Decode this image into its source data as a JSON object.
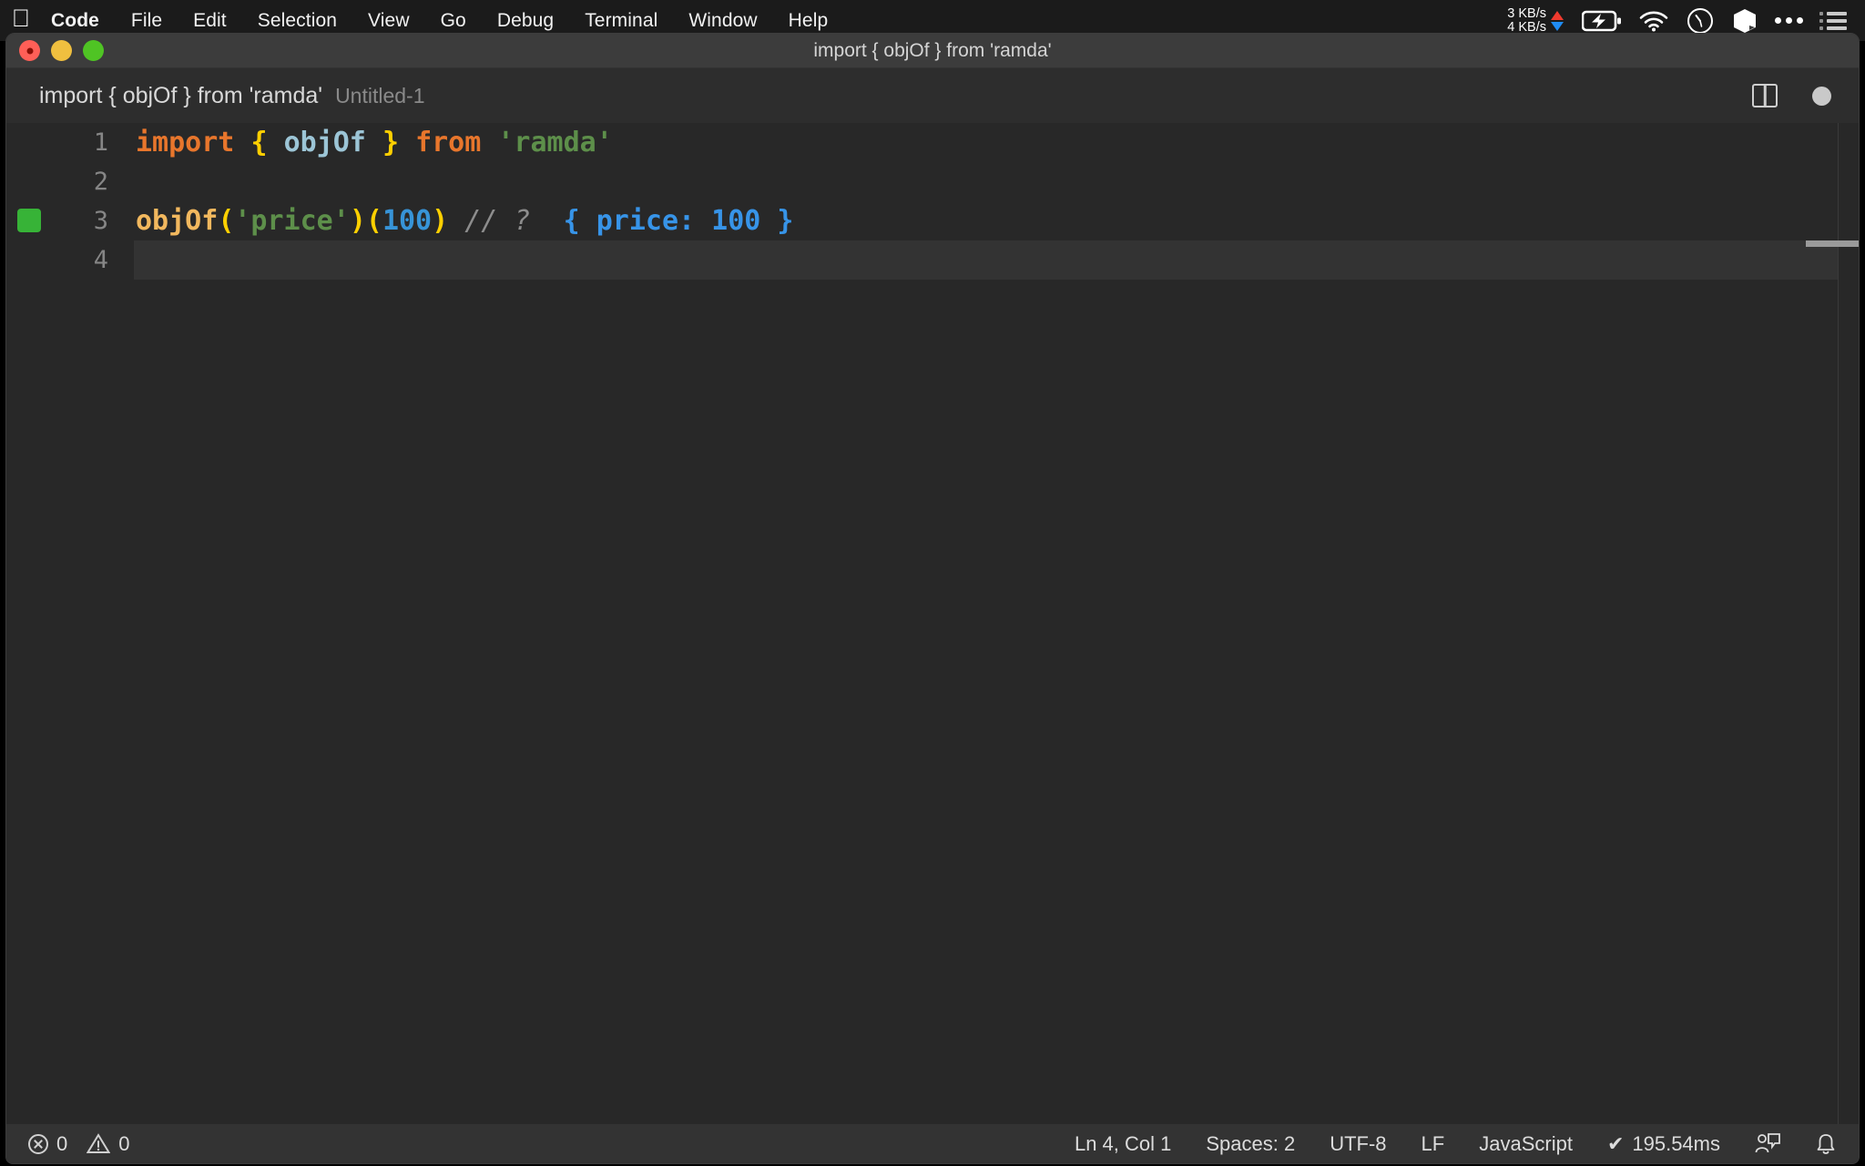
{
  "menubar": {
    "apple_icon": "apple-logo-icon",
    "items": [
      {
        "label": "Code",
        "bold": true
      },
      {
        "label": "File",
        "bold": false
      },
      {
        "label": "Edit",
        "bold": false
      },
      {
        "label": "Selection",
        "bold": false
      },
      {
        "label": "View",
        "bold": false
      },
      {
        "label": "Go",
        "bold": false
      },
      {
        "label": "Debug",
        "bold": false
      },
      {
        "label": "Terminal",
        "bold": false
      },
      {
        "label": "Window",
        "bold": false
      },
      {
        "label": "Help",
        "bold": false
      }
    ],
    "status": {
      "net_up": "3 KB/s",
      "net_down": "4 KB/s",
      "icons": [
        "battery-charging-icon",
        "wifi-icon",
        "clock-icon",
        "box-icon",
        "ellipsis-icon",
        "control-center-icon"
      ]
    }
  },
  "window": {
    "title": "import { objOf } from 'ramda'",
    "traffic_lights": [
      "close-button",
      "minimize-button",
      "maximize-button"
    ]
  },
  "tabbar": {
    "title": "import { objOf } from 'ramda'",
    "subtitle": "Untitled-1",
    "split_icon": "split-editor-icon",
    "dirty_icon": "unsaved-changes-dot"
  },
  "editor": {
    "lines": [
      {
        "number": "1",
        "marker": false,
        "current": false,
        "tokens": [
          {
            "t": "import",
            "c": "k-kw"
          },
          {
            "t": " ",
            "c": "k-plain"
          },
          {
            "t": "{",
            "c": "k-brc"
          },
          {
            "t": " ",
            "c": "k-plain"
          },
          {
            "t": "objOf",
            "c": "k-id"
          },
          {
            "t": " ",
            "c": "k-plain"
          },
          {
            "t": "}",
            "c": "k-brc"
          },
          {
            "t": " ",
            "c": "k-plain"
          },
          {
            "t": "from",
            "c": "k-kw"
          },
          {
            "t": " ",
            "c": "k-plain"
          },
          {
            "t": "'ramda'",
            "c": "k-str"
          }
        ]
      },
      {
        "number": "2",
        "marker": false,
        "current": false,
        "tokens": []
      },
      {
        "number": "3",
        "marker": true,
        "current": false,
        "tokens": [
          {
            "t": "objOf",
            "c": "k-fn"
          },
          {
            "t": "(",
            "c": "k-brc"
          },
          {
            "t": "'price'",
            "c": "k-str"
          },
          {
            "t": ")",
            "c": "k-brc"
          },
          {
            "t": "(",
            "c": "k-brc"
          },
          {
            "t": "100",
            "c": "k-num"
          },
          {
            "t": ")",
            "c": "k-brc"
          },
          {
            "t": " ",
            "c": "k-plain"
          },
          {
            "t": "// ?",
            "c": "k-cmt"
          },
          {
            "t": "  ",
            "c": "k-plain"
          },
          {
            "t": "{ price: 100 }",
            "c": "k-res"
          }
        ]
      },
      {
        "number": "4",
        "marker": false,
        "current": true,
        "tokens": []
      }
    ]
  },
  "statusbar": {
    "errors": "0",
    "warnings": "0",
    "cursor": "Ln 4, Col 1",
    "indent": "Spaces: 2",
    "encoding": "UTF-8",
    "eol": "LF",
    "language": "JavaScript",
    "runtime": "195.54ms",
    "runtime_check": "✔",
    "feedback_icon": "feedback-person-icon",
    "bell_icon": "notifications-bell-icon"
  }
}
